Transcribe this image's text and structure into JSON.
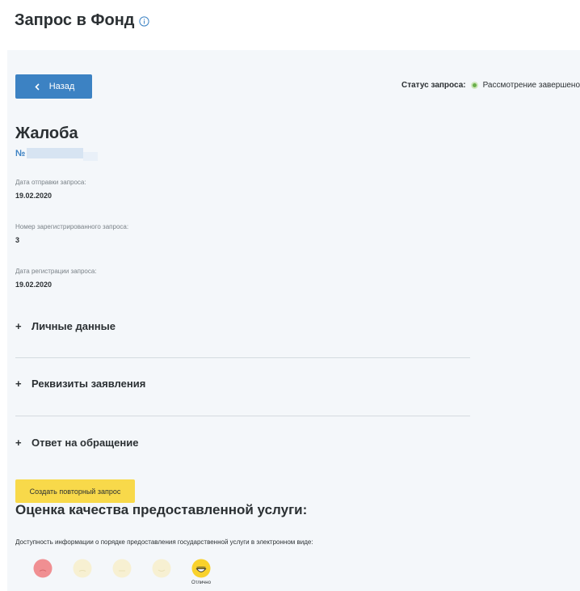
{
  "header": {
    "title": "Запрос в Фонд",
    "info_icon": "info-circle-icon"
  },
  "toolbar": {
    "back_label": "Назад",
    "back_icon": "chevron-left-icon"
  },
  "status": {
    "label": "Статус запроса:",
    "value": "Рассмотрение завершено",
    "color": "#6ab04c"
  },
  "request": {
    "title": "Жалоба",
    "number_prefix": "№",
    "fields": [
      {
        "label": "Дата отправки запроса:",
        "value": "19.02.2020"
      },
      {
        "label": "Номер зарегистрированного запроса:",
        "value": "3"
      },
      {
        "label": "Дата регистрации запроса:",
        "value": "19.02.2020"
      }
    ]
  },
  "sections": [
    {
      "label": "Личные данные",
      "icon": "plus-icon"
    },
    {
      "label": "Реквизиты заявления",
      "icon": "plus-icon"
    },
    {
      "label": "Ответ на обращение",
      "icon": "plus-icon"
    }
  ],
  "actions": {
    "repeat_request_label": "Создать повторный запрос"
  },
  "rating": {
    "title": "Оценка качества предоставленной услуги:",
    "question": "Доступность информации о порядке предоставления государственной услуги в электронном виде:",
    "options": [
      {
        "name": "very-bad-face-icon",
        "color": "#f08f92",
        "label": ""
      },
      {
        "name": "bad-face-icon",
        "color": "#f7f0d2",
        "label": ""
      },
      {
        "name": "neutral-face-icon",
        "color": "#f7f0d2",
        "label": ""
      },
      {
        "name": "good-face-icon",
        "color": "#f7f0d2",
        "label": ""
      },
      {
        "name": "excellent-face-icon",
        "color": "#f9d22c",
        "label": "Отлично",
        "selected": true
      }
    ]
  },
  "colors": {
    "accent": "#3c82c3",
    "button_yellow": "#f8d94a",
    "panel_bg": "#f4f7fa"
  }
}
